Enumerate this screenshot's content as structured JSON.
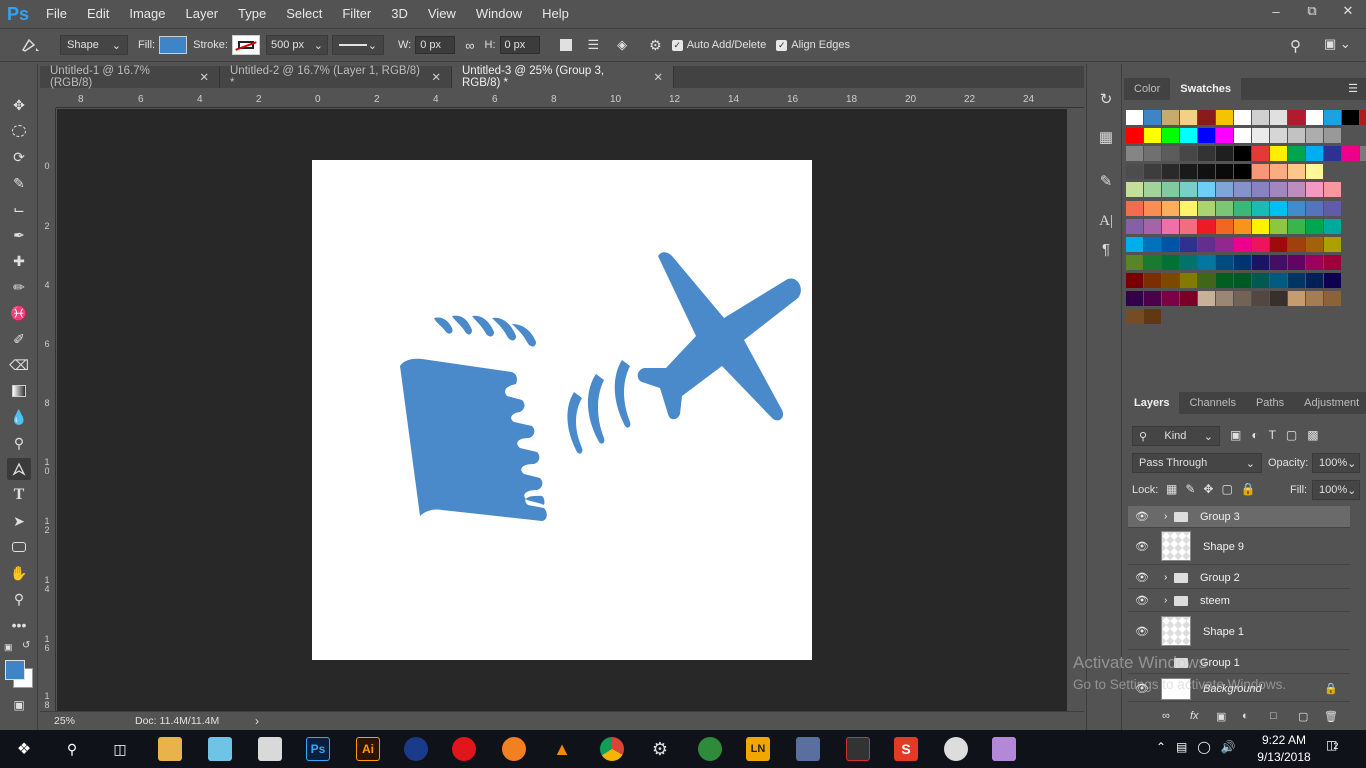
{
  "app": {
    "logo": "Ps"
  },
  "menu": [
    "File",
    "Edit",
    "Image",
    "Layer",
    "Type",
    "Select",
    "Filter",
    "3D",
    "View",
    "Window",
    "Help"
  ],
  "window_controls": [
    "minimize",
    "restore",
    "close"
  ],
  "options": {
    "mode": "Shape",
    "fill_label": "Fill:",
    "fill_color": "#3d85c6",
    "stroke_label": "Stroke:",
    "stroke_width": "500 px",
    "w_label": "W:",
    "w_value": "0 px",
    "h_label": "H:",
    "h_value": "0 px",
    "auto_add_delete": "Auto Add/Delete",
    "align_edges": "Align Edges"
  },
  "tabs": [
    {
      "label": "Untitled-1 @ 16.7% (RGB/8)",
      "active": false
    },
    {
      "label": "Untitled-2 @ 16.7% (Layer 1, RGB/8) *",
      "active": false
    },
    {
      "label": "Untitled-3 @ 25% (Group 3, RGB/8) *",
      "active": true
    }
  ],
  "ruler": {
    "top": [
      "8",
      "6",
      "4",
      "2",
      "0",
      "2",
      "4",
      "6",
      "8",
      "10",
      "12",
      "14",
      "16",
      "18",
      "20",
      "22",
      "24"
    ],
    "left": [
      "0",
      "2",
      "4",
      "6",
      "8",
      "10",
      "12",
      "14",
      "16",
      "18"
    ]
  },
  "status": {
    "zoom": "25%",
    "doc": "Doc: 11.4M/11.4M"
  },
  "swatches_panel": {
    "tabs": [
      "Color",
      "Swatches"
    ],
    "active": "Swatches"
  },
  "swatch_colors": [
    [
      "#ffffff",
      "#3d85c6",
      "#c8a96e",
      "#f2d085",
      "#8b1a1a",
      "#f5c400",
      "#ffffff",
      "#d0d0d0",
      "#e0e0e0",
      "#b01c2e",
      "#ffffff",
      "#1aa3e0",
      "#000000",
      "#b01c1c"
    ],
    [
      "#ff0000",
      "#ffff00",
      "#00ff00",
      "#00ffff",
      "#0000ff",
      "#ff00ff",
      "#ffffff",
      "#ebebeb",
      "#d6d6d6",
      "#c2c2c2",
      "#adadad",
      "#999999"
    ],
    [
      "#858585",
      "#707070",
      "#5c5c5c",
      "#474747",
      "#333333",
      "#1f1f1f",
      "#000000",
      "#e53935",
      "#ffee00",
      "#00a550",
      "#00aeef",
      "#2e3192",
      "#ec008c",
      "#7b7b7b",
      "#5a5a5a"
    ],
    [
      "#4d4d4d",
      "#3d3d3d",
      "#2a2a2a",
      "#1a1a1a",
      "#111111",
      "#0a0a0a",
      "#000000",
      "#f7977a",
      "#f9ad81",
      "#fdc68a",
      "#fff79a"
    ],
    [
      "#c4df9b",
      "#a3d39c",
      "#82ca9d",
      "#7bcdc8",
      "#6ecff6",
      "#7ea7d8",
      "#8493ca",
      "#8882be",
      "#a187be",
      "#bc8dbf",
      "#f49ac2",
      "#f6989d"
    ],
    [
      "#f26c4f",
      "#f68e55",
      "#fbaf5c",
      "#fff467",
      "#acd372",
      "#7cc576",
      "#3bb878",
      "#1abbb4",
      "#00bff3",
      "#438ccb",
      "#5574b9",
      "#605ca8"
    ],
    [
      "#855fa8",
      "#a763a8",
      "#f06ea9",
      "#f26d7d",
      "#ed1c24",
      "#f26522",
      "#f7941d",
      "#fff200",
      "#8dc63f",
      "#39b54a",
      "#00a651",
      "#00a99d"
    ],
    [
      "#00aeef",
      "#0072bc",
      "#0054a6",
      "#2e3192",
      "#662d91",
      "#92278f",
      "#ec008c",
      "#ed145b",
      "#9e0b0f",
      "#a0410d",
      "#a36209",
      "#aba000"
    ],
    [
      "#598527",
      "#197b30",
      "#007236",
      "#00746b",
      "#0076a3",
      "#004b80",
      "#003471",
      "#1b1464",
      "#440e62",
      "#630460",
      "#9e005d",
      "#9e0039"
    ],
    [
      "#790000",
      "#7b2e00",
      "#7d4900",
      "#827b00",
      "#406618",
      "#005e20",
      "#005826",
      "#005952",
      "#005b7f",
      "#003663",
      "#002157",
      "#0d004c"
    ],
    [
      "#32004b",
      "#4b0049",
      "#7b0046",
      "#7a0026",
      "#c7b299",
      "#998675",
      "#736357",
      "#534741",
      "#37302d",
      "#c69c6d",
      "#a67c52",
      "#8c6239"
    ],
    [
      "#754c24",
      "#603913"
    ]
  ],
  "layers_panel": {
    "tabs": [
      "Layers",
      "Channels",
      "Paths",
      "Adjustment"
    ],
    "active": "Layers",
    "kind": "Kind",
    "blend": "Pass Through",
    "opacity_label": "Opacity:",
    "opacity": "100%",
    "lock_label": "Lock:",
    "fill_label": "Fill:",
    "fill": "100%",
    "layers": [
      {
        "name": "Group 3",
        "type": "group",
        "selected": true
      },
      {
        "name": "Shape 9",
        "type": "shape",
        "selected": false
      },
      {
        "name": "Group 2",
        "type": "group",
        "selected": false
      },
      {
        "name": "steem",
        "type": "group",
        "selected": false
      },
      {
        "name": "Shape 1",
        "type": "shape",
        "selected": false
      },
      {
        "name": "Group 1",
        "type": "group",
        "selected": false
      },
      {
        "name": "Background",
        "type": "background",
        "selected": false
      }
    ]
  },
  "watermark": {
    "line1": "Activate Windows",
    "line2": "Go to Settings to activate Windows."
  },
  "taskbar": {
    "ai_label": "Ai",
    "ps_label": "Ps",
    "ln_label": "LN",
    "time": "9:22 AM",
    "date": "9/13/2018",
    "notifications": "2"
  },
  "colors": {
    "accent": "#3d85c6",
    "bg": "#535353",
    "canvas_bg": "#282828"
  }
}
